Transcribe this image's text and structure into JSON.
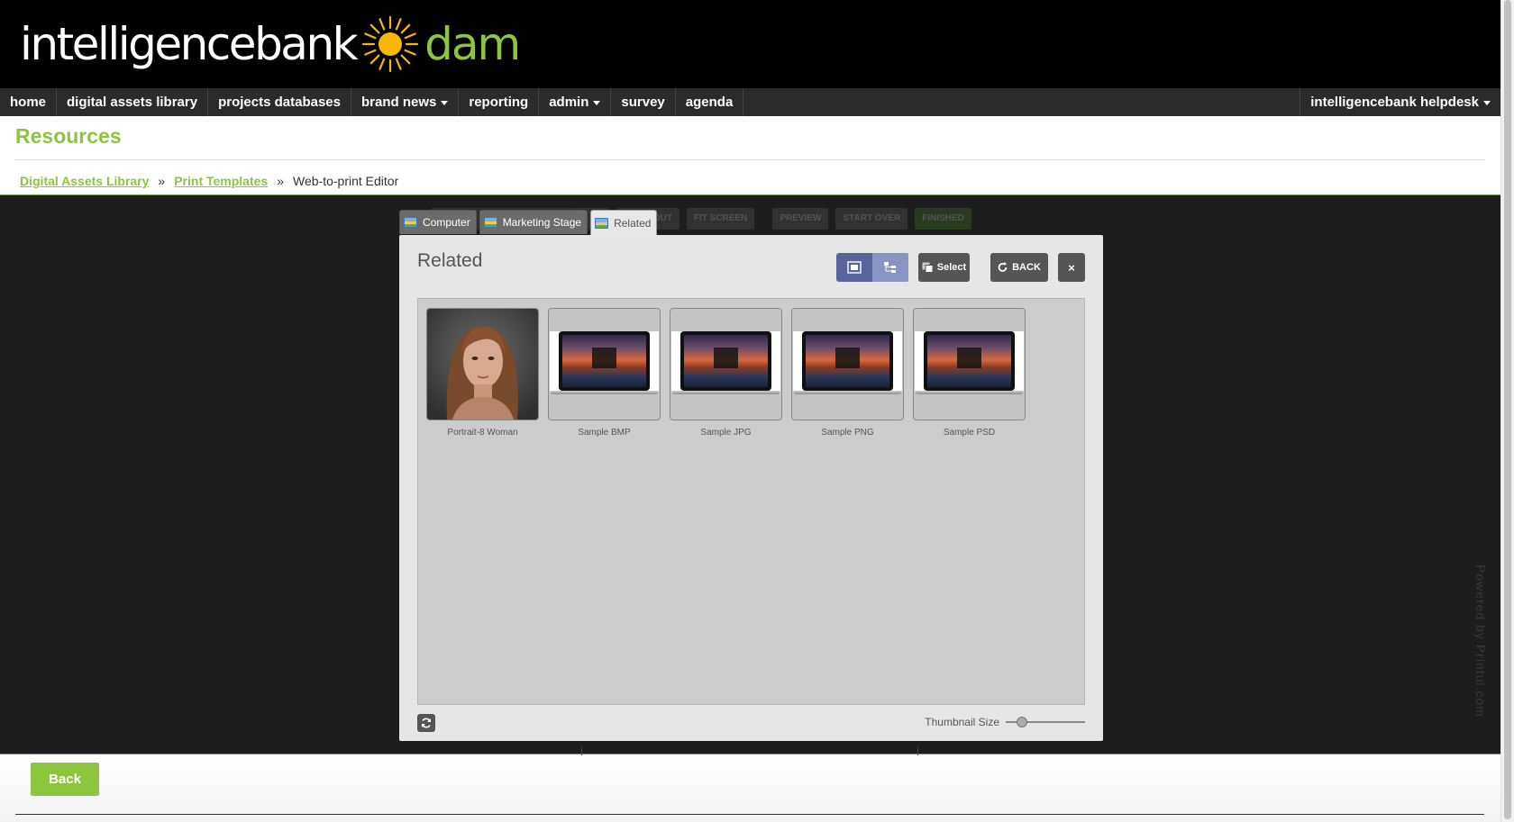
{
  "brand": {
    "logo_word_1": "intelligencebank",
    "logo_word_2": "dam",
    "accent_color": "#8cc63f"
  },
  "nav": {
    "items": [
      {
        "label": "home",
        "has_dropdown": false
      },
      {
        "label": "digital assets library",
        "has_dropdown": false
      },
      {
        "label": "projects databases",
        "has_dropdown": false
      },
      {
        "label": "brand news",
        "has_dropdown": true
      },
      {
        "label": "reporting",
        "has_dropdown": false
      },
      {
        "label": "admin",
        "has_dropdown": true
      },
      {
        "label": "survey",
        "has_dropdown": false
      },
      {
        "label": "agenda",
        "has_dropdown": false
      }
    ],
    "right_item": {
      "label": "intelligencebank helpdesk",
      "has_dropdown": true
    }
  },
  "page": {
    "title": "Resources",
    "breadcrumb": [
      {
        "label": "Digital Assets Library",
        "link": true
      },
      {
        "label": "Print Templates",
        "link": true
      },
      {
        "label": "Web-to-print Editor",
        "link": false
      }
    ],
    "breadcrumb_separator": "»"
  },
  "editor": {
    "ghost_toolbar": [
      "ZOOM OUT",
      "FIT SCREEN",
      "PREVIEW",
      "START OVER",
      "FINISHED"
    ],
    "watermark": "Powered by Printui.com",
    "tabs": [
      {
        "label": "Computer",
        "active": false
      },
      {
        "label": "Marketing Stage",
        "active": false
      },
      {
        "label": "Related",
        "active": true
      }
    ]
  },
  "dialog": {
    "title": "Related",
    "select_label": "Select",
    "back_label": "BACK",
    "close_label": "×",
    "thumbnails": [
      {
        "caption": "Portrait-8 Woman",
        "kind": "portrait"
      },
      {
        "caption": "Sample BMP",
        "kind": "laptop"
      },
      {
        "caption": "Sample JPG",
        "kind": "laptop"
      },
      {
        "caption": "Sample PNG",
        "kind": "laptop"
      },
      {
        "caption": "Sample PSD",
        "kind": "laptop"
      }
    ],
    "thumbnail_size_label": "Thumbnail Size",
    "thumbnail_size_level": 0.15
  },
  "footer": {
    "back_label": "Back"
  }
}
